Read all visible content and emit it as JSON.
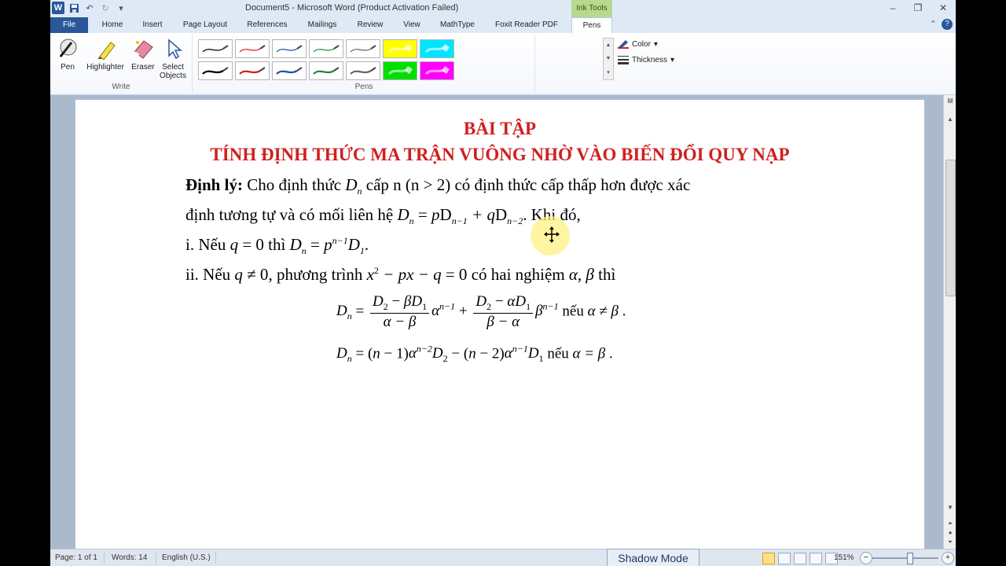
{
  "window": {
    "title": "Document5 - Microsoft Word (Product Activation Failed)",
    "ink_tools_label": "Ink Tools",
    "controls": {
      "minimize": "–",
      "restore": "❐",
      "close": "✕"
    }
  },
  "tabs": [
    "File",
    "Home",
    "Insert",
    "Page Layout",
    "References",
    "Mailings",
    "Review",
    "View",
    "MathType",
    "Foxit Reader PDF",
    "Pens"
  ],
  "active_tab": "Pens",
  "ribbon": {
    "write_group": {
      "label": "Write",
      "buttons": [
        {
          "label": "Pen",
          "icon": "pen-icon"
        },
        {
          "label": "Highlighter",
          "icon": "highlighter-icon"
        },
        {
          "label": "Eraser",
          "icon": "eraser-icon"
        },
        {
          "label": "Select Objects",
          "icon": "select-objects-icon"
        }
      ]
    },
    "pens_group": {
      "label": "Pens",
      "row1_colors": [
        "#000000",
        "#d01f1f",
        "#1f4fa8",
        "#1e8a3a",
        "#666666",
        "#ffff00",
        "#00e5ff"
      ],
      "row2_colors": [
        "#000000",
        "#d01f1f",
        "#1f4fa8",
        "#1e8a3a",
        "#666666",
        "#00e000",
        "#ff00ff"
      ],
      "color_label": "Color",
      "thickness_label": "Thickness"
    }
  },
  "document": {
    "title1": "BÀI TẬP",
    "title2": "TÍNH ĐỊNH THỨC MA TRẬN VUÔNG NHỜ VÀO BIẾN ĐỔI QUY NẠP",
    "theorem_label": "Định lý:",
    "line1_text": " Cho định thức ",
    "line1_rest": " cấp n (n > 2) có định thức cấp thấp hơn được xác",
    "line2_text": "định tương tự và có mối liên hệ ",
    "line2_end": ". Khi đó,",
    "line3_prefix": "i. Nếu ",
    "line3_mid": " thì ",
    "line4_prefix": "ii. Nếu ",
    "line4_mid": ", phương trình ",
    "line4_mid2": " có hai nghiệm ",
    "line4_end": " thì",
    "eq1_tail": " nếu ",
    "eq2_tail": " nếu "
  },
  "status": {
    "page": "Page: 1 of 1",
    "words": "Words: 14",
    "language": "English (U.S.)",
    "shadow_mode": "Shadow Mode",
    "zoom": "151%"
  }
}
